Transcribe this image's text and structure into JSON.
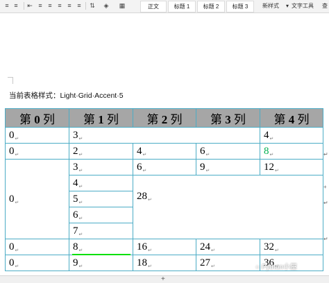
{
  "toolbar": {
    "style_tiles": [
      "正文",
      "标题 1",
      "标题 2",
      "标题 3"
    ],
    "new_style": "新样式",
    "text_tools": "文字工具",
    "search_partial": "查"
  },
  "document": {
    "style_caption": "当前表格样式：Light·Grid·Accent·5",
    "table": {
      "headers": [
        {
          "pre": "第 ",
          "num": "0",
          "post": " 列"
        },
        {
          "pre": "第 ",
          "num": "1",
          "post": " 列"
        },
        {
          "pre": "第 ",
          "num": "2",
          "post": " 列"
        },
        {
          "pre": "第 ",
          "num": "3",
          "post": " 列"
        },
        {
          "pre": "第 ",
          "num": "4",
          "post": " 列"
        }
      ],
      "r1": {
        "c0": "0",
        "c1": "3",
        "c4": "4"
      },
      "r2": {
        "c0": "0",
        "c1": "2",
        "c2": "4",
        "c3": "6",
        "c4": "8"
      },
      "r3": {
        "c0": "0",
        "c1": "3",
        "c2": "6",
        "c3": "9",
        "c4": "12"
      },
      "r4": {
        "c1": "4",
        "c2": "28"
      },
      "r5": {
        "c1": "5"
      },
      "r6": {
        "c1": "6"
      },
      "r7": {
        "c1": "7"
      },
      "r8": {
        "c0": "0",
        "c1": "8",
        "c2": "16",
        "c3": "24",
        "c4": "32"
      },
      "r9": {
        "c0": "0",
        "c1": "9",
        "c2": "18",
        "c3": "27",
        "c4": "36"
      }
    },
    "highlight_color": "#00b050",
    "border_color": "#4bacc6",
    "header_fill": "#a6a6a6"
  },
  "watermark": "Python小屋"
}
